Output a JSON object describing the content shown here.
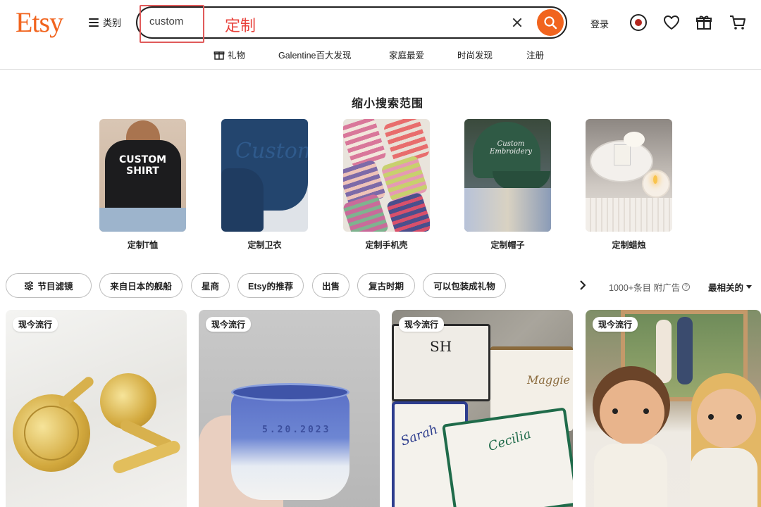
{
  "header": {
    "logo": "Etsy",
    "categories_label": "类别",
    "search_value": "custom",
    "annotation": "定制",
    "signin_label": "登录"
  },
  "subnav": {
    "items": [
      {
        "label": "礼物",
        "icon": "gift-icon"
      },
      {
        "label": "Galentine百大发现"
      },
      {
        "label": "家庭最爱"
      },
      {
        "label": "时尚发现"
      },
      {
        "label": "注册"
      }
    ]
  },
  "narrow": {
    "title": "缩小搜索范围",
    "categories": [
      {
        "label": "定制T恤",
        "image_text": "CUSTOM\nSHIRT"
      },
      {
        "label": "定制卫衣",
        "image_text": "Custom"
      },
      {
        "label": "定制手机壳"
      },
      {
        "label": "定制帽子",
        "image_text": "Custom\nEmbroidery"
      },
      {
        "label": "定制蜡烛"
      }
    ]
  },
  "filters": {
    "chips": [
      {
        "label": "节目滤镜",
        "icon": "sliders-icon"
      },
      {
        "label": "来自日本的舰船"
      },
      {
        "label": "星商"
      },
      {
        "label": "Etsy的推荐"
      },
      {
        "label": "出售"
      },
      {
        "label": "复古时期"
      },
      {
        "label": "可以包装成礼物"
      }
    ],
    "results_text": "1000+条目 附广告",
    "sort_label": "最相关的"
  },
  "products": {
    "badge": "现今流行",
    "items": [
      {
        "kind": "cufflinks"
      },
      {
        "kind": "mug",
        "engraving": "5.20.2023"
      },
      {
        "kind": "tote-bags",
        "names": [
          "SH",
          "Maggie",
          "Sarah",
          "Cecilia"
        ]
      },
      {
        "kind": "dolls"
      }
    ]
  },
  "colors": {
    "brand": "#F1641E",
    "annotation": "#E8413A"
  }
}
